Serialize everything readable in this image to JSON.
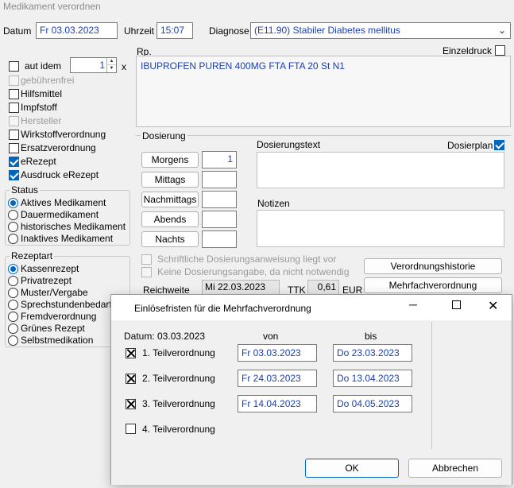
{
  "window": {
    "title": "Medikament verordnen"
  },
  "header": {
    "datum_label": "Datum",
    "datum_value": "Fr 03.03.2023",
    "uhrzeit_label": "Uhrzeit",
    "uhrzeit_value": "15:07",
    "diagnose_label": "Diagnose",
    "diagnose_value": "(E11.90) Stabiler Diabetes mellitus"
  },
  "left": {
    "aut_idem_label": "aut idem",
    "aut_idem_qty": "1",
    "times_label": "x",
    "options": [
      {
        "label": "gebührenfrei",
        "checked": false,
        "disabled": true
      },
      {
        "label": "Hilfsmittel",
        "checked": false,
        "disabled": false
      },
      {
        "label": "Impfstoff",
        "checked": false,
        "disabled": false
      },
      {
        "label": "Hersteller",
        "checked": false,
        "disabled": true
      },
      {
        "label": "Wirkstoffverordnung",
        "checked": false,
        "disabled": false
      },
      {
        "label": "Ersatzverordnung",
        "checked": false,
        "disabled": false
      },
      {
        "label": "eRezept",
        "checked": true,
        "disabled": false
      },
      {
        "label": "Ausdruck eRezept",
        "checked": true,
        "disabled": false
      }
    ],
    "status": {
      "title": "Status",
      "items": [
        "Aktives Medikament",
        "Dauermedikament",
        "historisches Medikament",
        "Inaktives Medikament"
      ]
    },
    "rezeptart": {
      "title": "Rezeptart",
      "items": [
        "Kassenrezept",
        "Privatrezept",
        "Muster/Vergabe",
        "Sprechstundenbedarf",
        "Fremdverordnung",
        "Grünes Rezept",
        "Selbstmedikation"
      ]
    }
  },
  "rx": {
    "label": "Rp.",
    "einzeldruck_label": "Einzeldruck",
    "text": "IBUPROFEN PUREN 400MG FTA FTA 20 St N1"
  },
  "dosierung": {
    "title": "Dosierung",
    "rows": [
      {
        "label": "Morgens",
        "value": "1"
      },
      {
        "label": "Mittags",
        "value": ""
      },
      {
        "label": "Nachmittags",
        "value": ""
      },
      {
        "label": "Abends",
        "value": ""
      },
      {
        "label": "Nachts",
        "value": ""
      }
    ],
    "dosierungstext_label": "Dosierungstext",
    "dosierplan_label": "Dosierplan",
    "notizen_label": "Notizen",
    "schriftlich_label": "Schriftliche Dosierungsanweisung liegt vor",
    "keine_label": "Keine Dosierungsangabe, da nicht notwendig",
    "verordnungshistorie_label": "Verordnungshistorie",
    "mehrfach_label": "Mehrfachverordnung",
    "reichweite_label": "Reichweite",
    "reichweite_value": "Mi 22.03.2023",
    "ttk_label": "TTK",
    "ttk_value": "0,61",
    "eur_label": "EUR"
  },
  "dialog": {
    "title": "Einlösefristen für die Mehrfachverordnung",
    "datum_label": "Datum: 03.03.2023",
    "von_label": "von",
    "bis_label": "bis",
    "rows": [
      {
        "label": "1. Teilverordnung",
        "checked": true,
        "von": "Fr 03.03.2023",
        "bis": "Do 23.03.2023"
      },
      {
        "label": "2. Teilverordnung",
        "checked": true,
        "von": "Fr 24.03.2023",
        "bis": "Do 13.04.2023"
      },
      {
        "label": "3. Teilverordnung",
        "checked": true,
        "von": "Fr 14.04.2023",
        "bis": "Do 04.05.2023"
      },
      {
        "label": "4. Teilverordnung",
        "checked": false
      }
    ],
    "ok_label": "OK",
    "cancel_label": "Abbrechen"
  }
}
